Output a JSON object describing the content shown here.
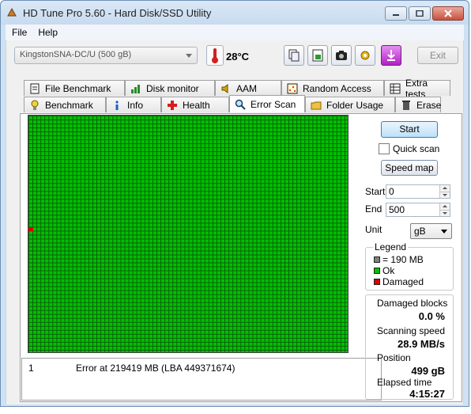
{
  "window": {
    "title": "HD Tune Pro 5.60 - Hard Disk/SSD Utility"
  },
  "menu": {
    "file": "File",
    "help": "Help"
  },
  "toolbar": {
    "drive": "KingstonSNA-DC/U (500 gB)",
    "temperature": "28",
    "temperature_unit": "°C",
    "exit_label": "Exit",
    "buttons": [
      "copy-info-icon",
      "save-icon",
      "camera-icon",
      "settings-icon",
      "download-icon"
    ]
  },
  "tabs": {
    "top": [
      "File Benchmark",
      "Disk monitor",
      "AAM",
      "Random Access",
      "Extra tests"
    ],
    "bottom": [
      "Benchmark",
      "Info",
      "Health",
      "Error Scan",
      "Folder Usage",
      "Erase"
    ],
    "active": "Error Scan"
  },
  "scan": {
    "start_label": "Start",
    "quick_scan_label": "Quick scan",
    "quick_scan_checked": false,
    "speed_map_label": "Speed map",
    "start_field_label": "Start",
    "start_value": "0",
    "end_field_label": "End",
    "end_value": "500",
    "unit_label": "Unit",
    "unit_value": "gB"
  },
  "legend": {
    "title": "Legend",
    "block_size": "= 190 MB",
    "ok": "Ok",
    "damaged": "Damaged",
    "block_color": "#808080",
    "ok_color": "#00c000",
    "damaged_color": "#d90000"
  },
  "stats": {
    "damaged_blocks_label": "Damaged blocks",
    "damaged_blocks_value": "0.0 %",
    "scanning_speed_label": "Scanning speed",
    "scanning_speed_value": "28.9 MB/s",
    "position_label": "Position",
    "position_value": "499 gB",
    "elapsed_label": "Elapsed time",
    "elapsed_value": "4:15:27"
  },
  "log": [
    {
      "index": "1",
      "message": "Error at 219419 MB (LBA 449371674)"
    }
  ],
  "grid": {
    "damaged_block_row_fraction": 0.47
  }
}
